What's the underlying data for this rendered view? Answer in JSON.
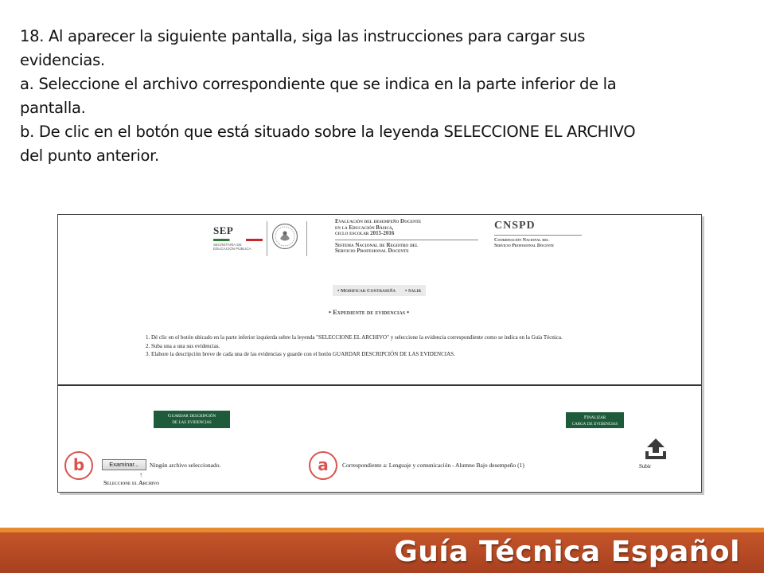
{
  "instructions": {
    "line1": "18. Al aparecer la siguiente pantalla, siga las instrucciones para cargar sus",
    "line2": "evidencias.",
    "line3": "a. Seleccione el archivo correspondiente que se indica en la parte inferior de la",
    "line4": "pantalla.",
    "line5": "b. De clic en el botón que está situado sobre la leyenda SELECCIONE EL ARCHIVO",
    "line6": "del punto anterior."
  },
  "screenshot": {
    "header": {
      "sep_title": "SEP",
      "sep_sub1": "SECRETARÍA DE",
      "sep_sub2": "EDUCACIÓN PÚBLICA",
      "center_title1": "Evaluación del desempeño Docente",
      "center_title2": "en la Educación Básica,",
      "center_title3": "ciclo escolar 2015-2016",
      "center_title4": "Sistema Nacional de Registro del",
      "center_title5": "Servicio Profesional Docente",
      "cnspd_title": "CNSPD",
      "cnspd_sub1": "Coordinación Nacional del",
      "cnspd_sub2": "Servicio Profesional Docente"
    },
    "menu": {
      "item1": "• Modificar Contraseña",
      "item2": "• Salir"
    },
    "expediente": "• Expediente de evidencias •",
    "steps": {
      "step1": "1. Dé clic en el botón ubicado en la parte inferior izquierda sobre la leyenda \"SELECCIONE EL ARCHIVO\" y seleccione la evidencia correspondiente como se indica en la Guía Técnica.",
      "step2": "2. Suba una a una sus evidencias.",
      "step3": "3. Elabore la descripción breve de cada una de las evidencias y guarde con el botón GUARDAR DESCRIPCIÓN DE LAS EVIDENCIAS."
    },
    "buttons": {
      "guardar_line1": "Guardar descripción",
      "guardar_line2": "de las evidencias",
      "finalizar_line1": "Finalizar",
      "finalizar_line2": "carga de evidencias",
      "examinar": "Examinar...",
      "subir": "Subir"
    },
    "labels": {
      "circle_b": "b",
      "circle_a": "a",
      "no_file": "Ningún archivo seleccionado.",
      "arrow": "↑",
      "select_file": "Seleccione el Archivo",
      "correspondiente": "Correspondiente a: Lenguaje y comunicación - Alumno Bajo desempeño (1)"
    },
    "accent_colors": {
      "button_green": "#1e5b3b",
      "marker_red": "#d9534f"
    }
  },
  "footer": {
    "title": "Guía Técnica Español",
    "colors": {
      "stripe": "#e88a2e",
      "band": "#b54a24"
    }
  }
}
